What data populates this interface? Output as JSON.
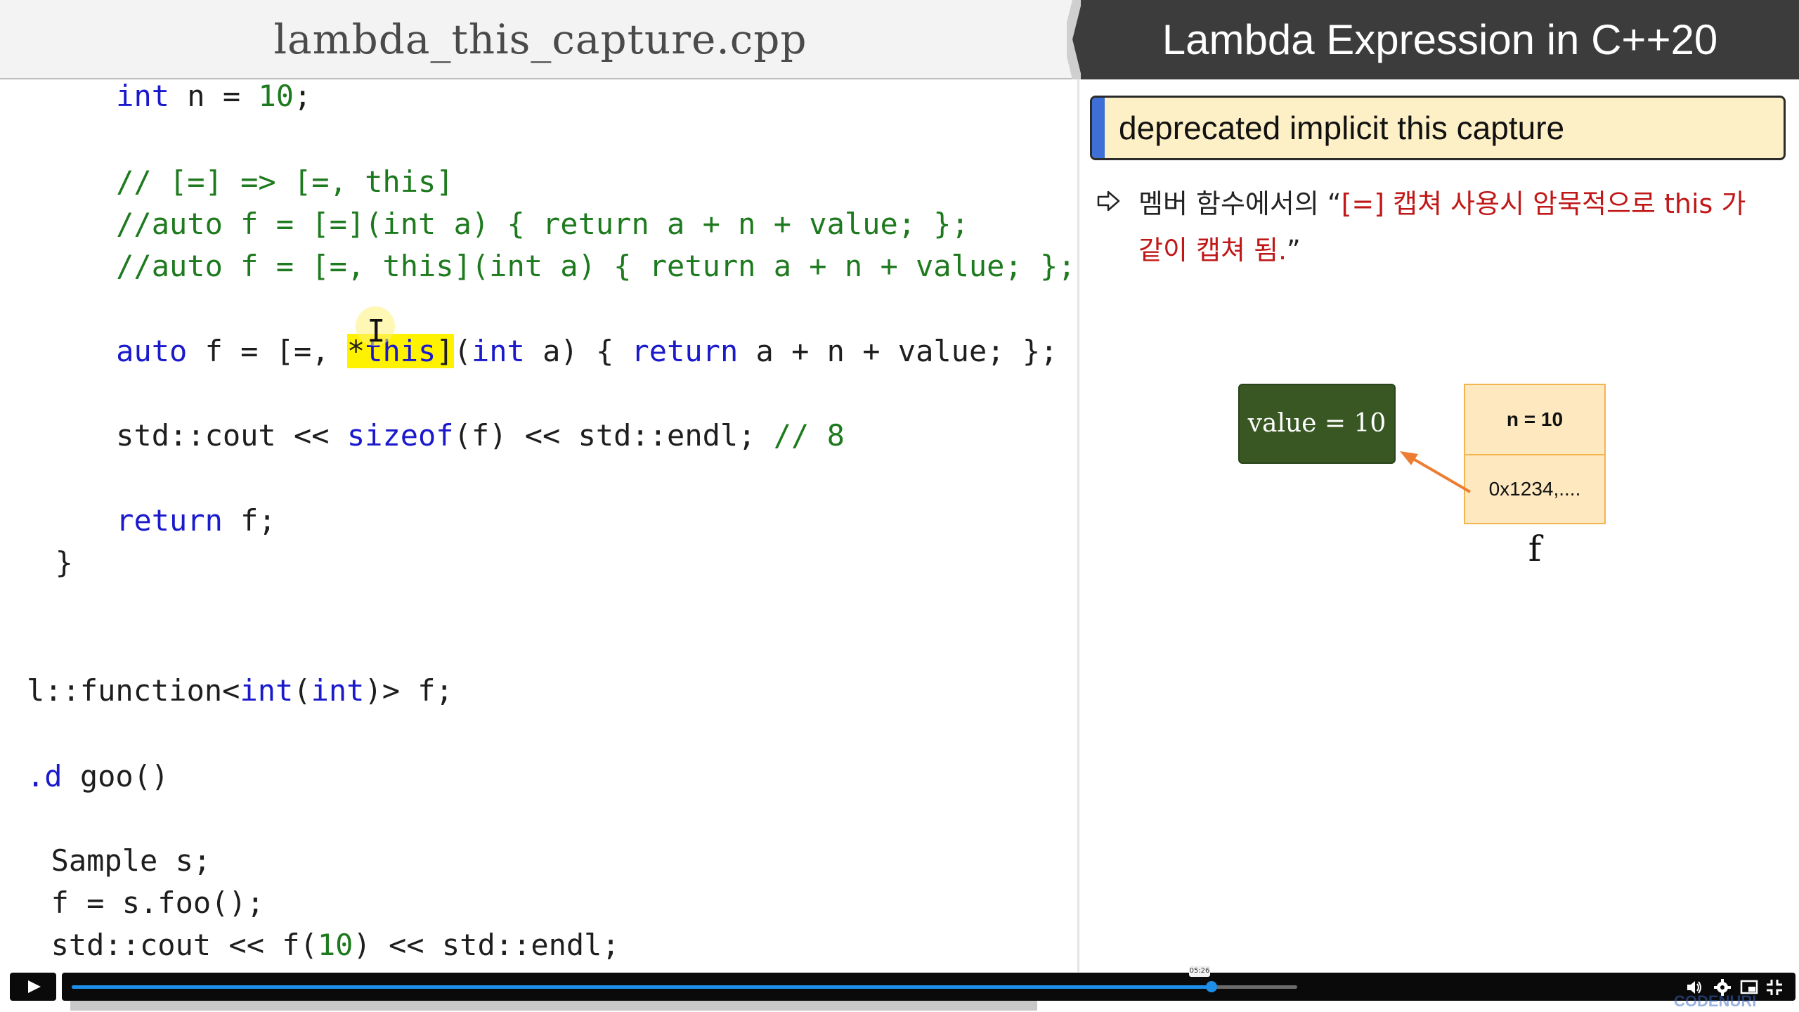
{
  "editor": {
    "file_title": "lambda_this_capture.cpp",
    "lines": [
      {
        "segments": [
          {
            "text": "    "
          },
          {
            "text": "int",
            "cls": "kw"
          },
          {
            "text": " n = "
          },
          {
            "text": "10",
            "cls": "num"
          },
          {
            "text": ";"
          }
        ]
      },
      {
        "segments": [
          {
            "text": "    // [=] => [=, this]",
            "cls": "cm"
          }
        ]
      },
      {
        "segments": [
          {
            "text": "    //auto f = [=](int a) { return a + n + value; };",
            "cls": "cm"
          }
        ]
      },
      {
        "segments": [
          {
            "text": "    //auto f = [=, this](int a) { return a + n + value; };",
            "cls": "cm"
          }
        ]
      },
      {
        "segments": [
          {
            "text": "    "
          },
          {
            "text": "auto",
            "cls": "kw"
          },
          {
            "text": " f = [=, "
          },
          {
            "text": "*",
            "cls": "hl"
          },
          {
            "text": "this",
            "cls": "kw hl"
          },
          {
            "text": "](",
            "cls": "hl-end"
          },
          {
            "text": "int",
            "cls": "kw"
          },
          {
            "text": " a) { "
          },
          {
            "text": "return",
            "cls": "kw"
          },
          {
            "text": " a + n + value; };"
          }
        ]
      },
      {
        "segments": [
          {
            "text": "    std::cout << "
          },
          {
            "text": "sizeof",
            "cls": "kw"
          },
          {
            "text": "(f) << std::endl; "
          },
          {
            "text": "// 8",
            "cls": "cm"
          }
        ]
      },
      {
        "segments": [
          {
            "text": "    "
          },
          {
            "text": "return",
            "cls": "kw"
          },
          {
            "text": " f;"
          }
        ]
      },
      {
        "segments": [
          {
            "text": "  }"
          }
        ]
      },
      {
        "segments": [
          {
            "text": "l::function<"
          },
          {
            "text": "int",
            "cls": "kw"
          },
          {
            "text": "("
          },
          {
            "text": "int",
            "cls": "kw"
          },
          {
            "text": ")> f;"
          }
        ]
      },
      {
        "segments": [
          {
            "text": ".d",
            "cls": "kw"
          },
          {
            "text": " goo()"
          }
        ]
      },
      {
        "segments": [
          {
            "text": "  Sample s;"
          }
        ]
      },
      {
        "segments": [
          {
            "text": "  f = s.foo();"
          }
        ]
      },
      {
        "segments": [
          {
            "text": "  std::cout << f("
          },
          {
            "text": "10",
            "cls": "num"
          },
          {
            "text": ") << std::endl;"
          }
        ]
      }
    ]
  },
  "slide": {
    "title": "Lambda Expression in C++20",
    "topic": "deprecated implicit this capture",
    "bullet_prefix": "멤버 함수에서의 “",
    "bullet_red_1": "[=] 캡쳐 사용시 암묵적으로 this 가",
    "bullet_red_2": "같이 캡쳐 됨.",
    "bullet_suffix": "”",
    "diagram": {
      "value_box": "value = 10",
      "cell_top": "n = 10",
      "cell_bottom": "0x1234,....",
      "object_label": "f"
    }
  },
  "player": {
    "time_tooltip": "05:26",
    "progress_fraction": 0.665,
    "buffered_fraction": 0.715,
    "brand": "CODENURI",
    "icons": [
      "play-icon",
      "volume-icon",
      "settings-gear-icon",
      "picture-in-picture-icon",
      "fullscreen-exit-icon"
    ]
  },
  "colors": {
    "slide_header_bg": "#3c3c3c",
    "topic_bg": "#fdf0c6",
    "topic_accent": "#3d6fd6",
    "value_box_bg": "#385723",
    "object_bg": "#fde8c0",
    "highlight": "#fff200",
    "keyword": "#1a1acc",
    "comment": "#1e7a1e",
    "progress": "#1f8ee8"
  }
}
